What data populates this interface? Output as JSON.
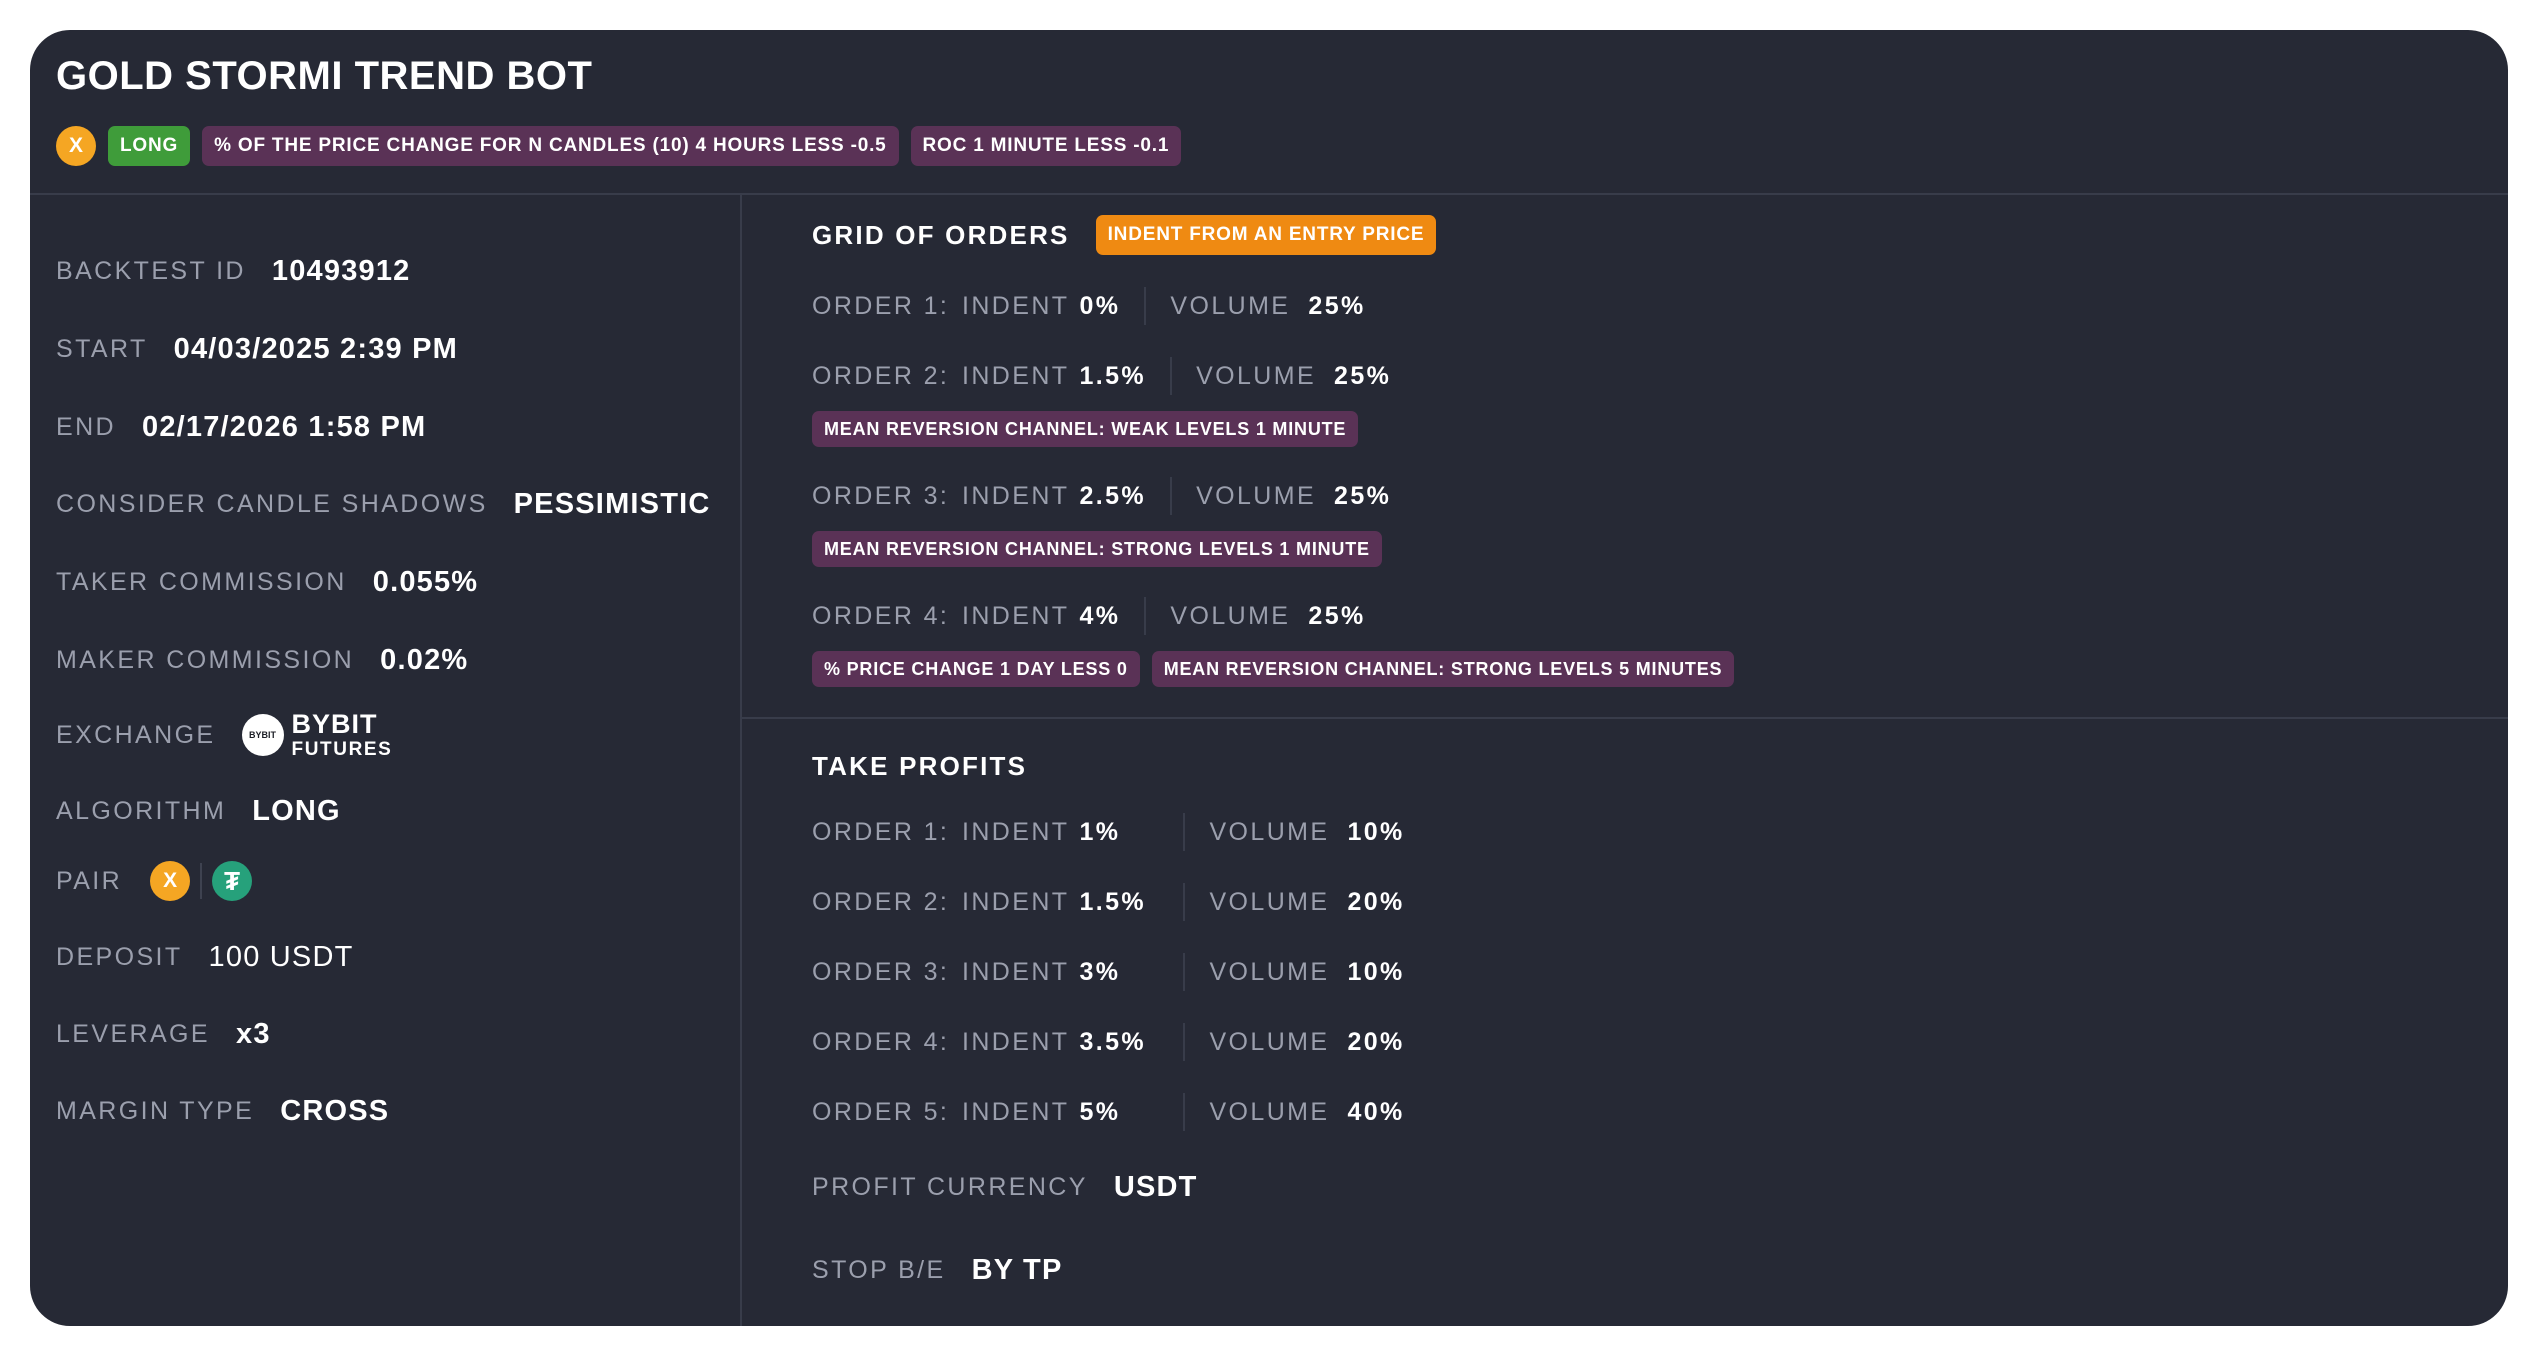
{
  "title": "GOLD STORMI TREND BOT",
  "header_tags": {
    "coin_symbol": "X",
    "direction": "LONG",
    "conditions": [
      "% OF THE PRICE CHANGE FOR N CANDLES (10) 4 HOURS LESS -0.5",
      "ROC 1 MINUTE LESS -0.1"
    ]
  },
  "colors": {
    "card_bg": "#262935",
    "accent_green": "#3f9c3a",
    "accent_purple": "#5a3256",
    "accent_orange": "#ef8a12",
    "gold_coin": "#f5a623",
    "usdt_coin": "#26a17b"
  },
  "details": {
    "backtest_id": {
      "label": "BACKTEST ID",
      "value": "10493912"
    },
    "start": {
      "label": "START",
      "value": "04/03/2025 2:39 PM"
    },
    "end": {
      "label": "END",
      "value": "02/17/2026 1:58 PM"
    },
    "candle_shadows": {
      "label": "CONSIDER CANDLE SHADOWS",
      "value": "PESSIMISTIC"
    },
    "taker": {
      "label": "TAKER COMMISSION",
      "value": "0.055%"
    },
    "maker": {
      "label": "MAKER COMMISSION",
      "value": "0.02%"
    },
    "exchange": {
      "label": "EXCHANGE",
      "logo_text": "BYBIT",
      "name": "BYBIT",
      "sub": "FUTURES",
      "icon": "bybit-logo-icon"
    },
    "algorithm": {
      "label": "ALGORITHM",
      "value": "LONG"
    },
    "pair": {
      "label": "PAIR",
      "base_symbol": "X",
      "quote_symbol": "₮",
      "base_icon": "gold-coin-icon",
      "quote_icon": "usdt-coin-icon"
    },
    "deposit": {
      "label": "DEPOSIT",
      "value": "100 USDT"
    },
    "leverage": {
      "label": "LEVERAGE",
      "value": "x3"
    },
    "margin_type": {
      "label": "MARGIN TYPE",
      "value": "CROSS"
    }
  },
  "grid": {
    "title": "GRID OF ORDERS",
    "badge": "INDENT FROM AN ENTRY PRICE",
    "indent_label": "INDENT",
    "volume_label": "VOLUME",
    "orders": [
      {
        "name": "ORDER 1:",
        "indent": "0%",
        "volume": "25%",
        "tags": []
      },
      {
        "name": "ORDER 2:",
        "indent": "1.5%",
        "volume": "25%",
        "tags": [
          "MEAN REVERSION CHANNEL: WEAK LEVELS 1 MINUTE"
        ]
      },
      {
        "name": "ORDER 3:",
        "indent": "2.5%",
        "volume": "25%",
        "tags": [
          "MEAN REVERSION CHANNEL: STRONG LEVELS 1 MINUTE"
        ]
      },
      {
        "name": "ORDER 4:",
        "indent": "4%",
        "volume": "25%",
        "tags": [
          "% PRICE CHANGE 1 DAY LESS 0",
          "MEAN REVERSION CHANNEL: STRONG LEVELS 5 MINUTES"
        ]
      }
    ]
  },
  "take_profits": {
    "title": "TAKE PROFITS",
    "indent_label": "INDENT",
    "volume_label": "VOLUME",
    "orders": [
      {
        "name": "ORDER 1:",
        "indent": "1%",
        "volume": "10%"
      },
      {
        "name": "ORDER 2:",
        "indent": "1.5%",
        "volume": "20%"
      },
      {
        "name": "ORDER 3:",
        "indent": "3%",
        "volume": "10%"
      },
      {
        "name": "ORDER 4:",
        "indent": "3.5%",
        "volume": "20%"
      },
      {
        "name": "ORDER 5:",
        "indent": "5%",
        "volume": "40%"
      }
    ],
    "profit_currency": {
      "label": "PROFIT CURRENCY",
      "value": "USDT"
    },
    "stop_be": {
      "label": "STOP B/E",
      "value": "BY TP"
    }
  }
}
